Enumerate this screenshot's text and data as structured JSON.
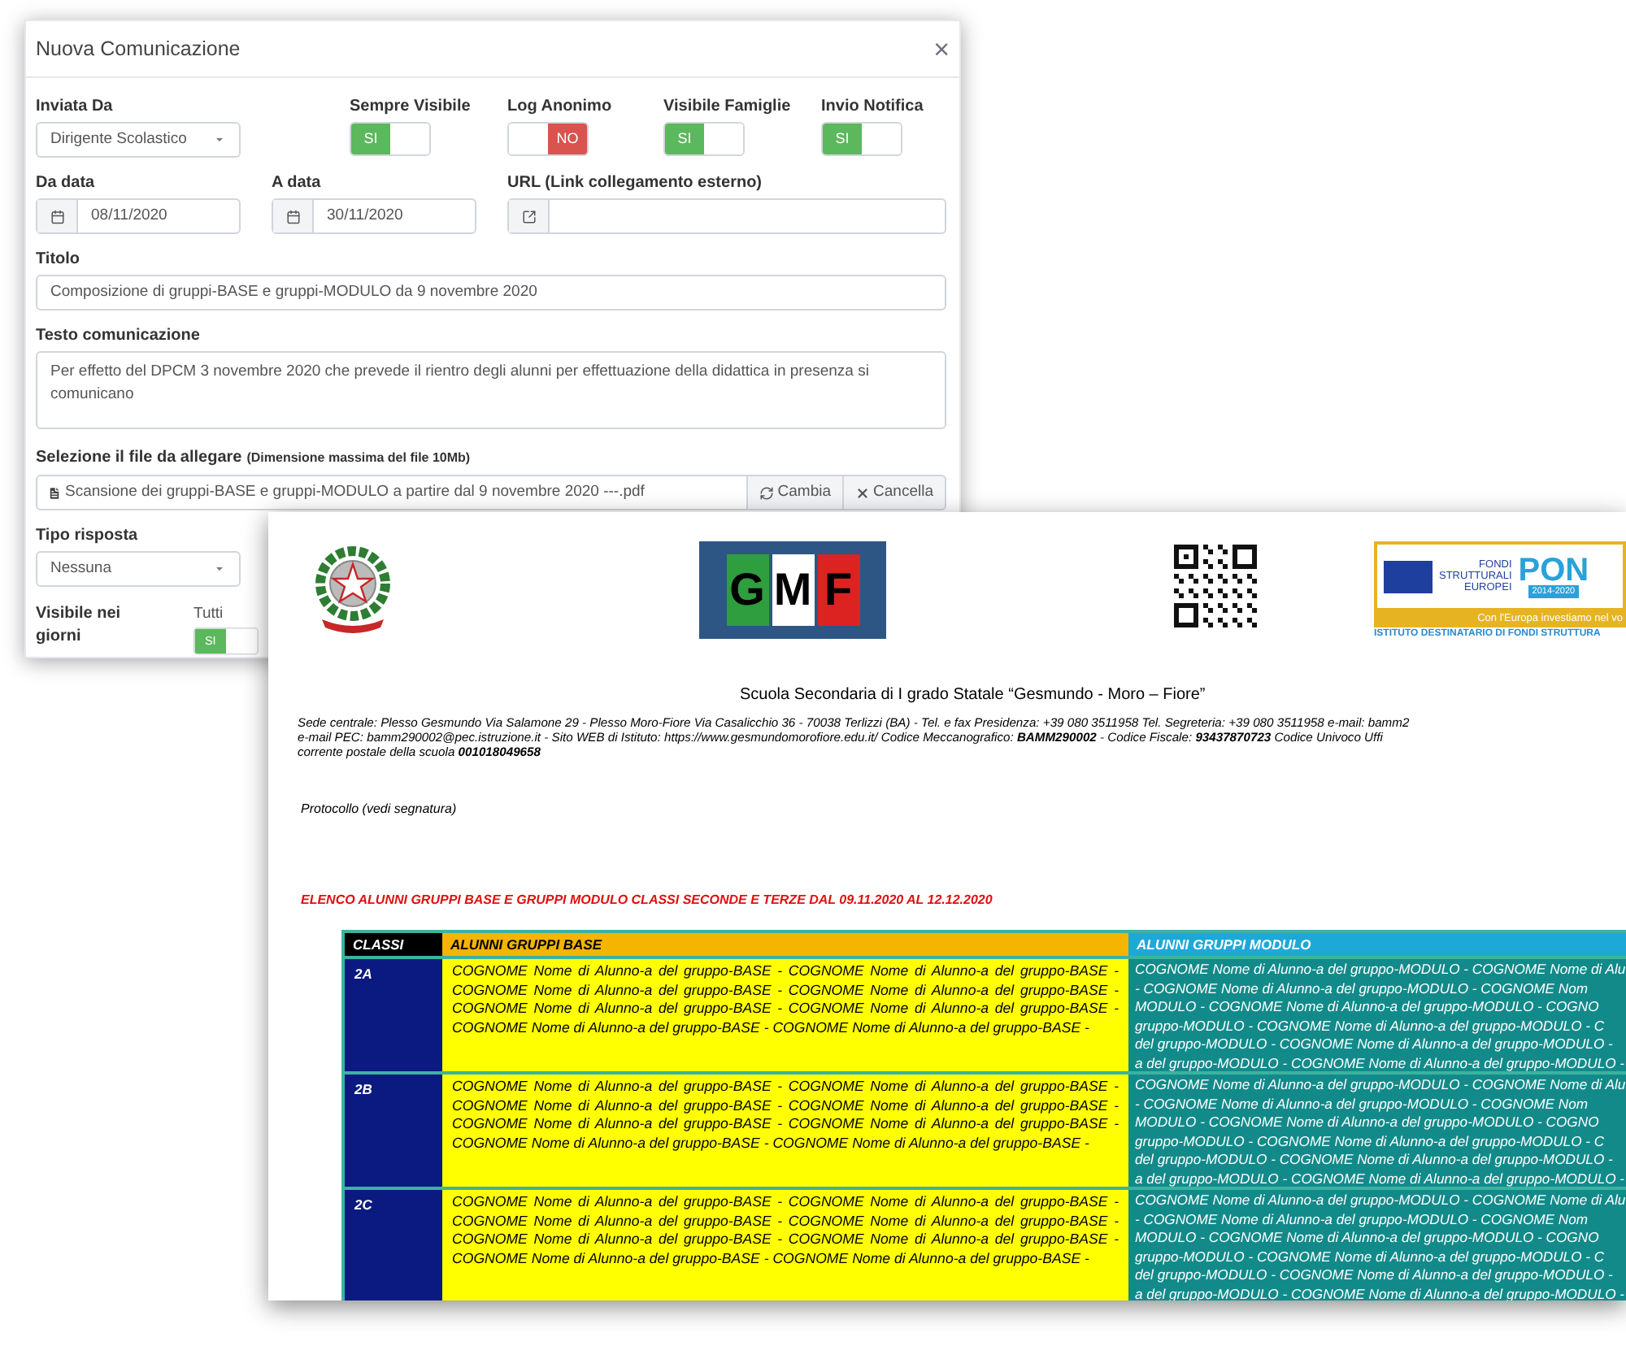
{
  "modal": {
    "title": "Nuova Comunicazione",
    "close": "×",
    "sender": {
      "label": "Inviata Da",
      "value": "Dirigente Scolastico"
    },
    "toggles": [
      {
        "label": "Sempre Visibile",
        "text": "SI",
        "on": true
      },
      {
        "label": "Log Anonimo",
        "text": "NO",
        "on": false
      },
      {
        "label": "Visibile Famiglie",
        "text": "SI",
        "on": true
      },
      {
        "label": "Invio Notifica",
        "text": "SI",
        "on": true
      }
    ],
    "dates": [
      {
        "label": "Da data",
        "value": "08/11/2020"
      },
      {
        "label": "A data",
        "value": "30/11/2020"
      }
    ],
    "url": {
      "label": "URL (Link collegamento esterno)"
    },
    "title_field": {
      "label": "Titolo",
      "value": "Composizione di gruppi-BASE e gruppi-MODULO da 9 novembre 2020"
    },
    "text_field": {
      "label": "Testo comunicazione",
      "value": "Per effetto del DPCM 3 novembre 2020 che prevede il rientro degli alunni per effettuazione della didattica in presenza si comunicano"
    },
    "attachment": {
      "label": "Selezione il file da allegare",
      "hint": "(Dimensione massima del file 10Mb)",
      "file": "Scansione dei gruppi-BASE e gruppi-MODULO a partire dal 9 novembre 2020 ---.pdf",
      "buttons": [
        {
          "kind": "change",
          "label": "Cambia"
        },
        {
          "kind": "clear",
          "label": "Cancella"
        }
      ]
    },
    "response": {
      "label": "Tipo risposta",
      "value": "Nessuna"
    },
    "days": {
      "label": "Visibile nei giorni",
      "option": "Tutti",
      "text": "SI",
      "on": true
    }
  },
  "document": {
    "gmf": [
      "G",
      "M",
      "F"
    ],
    "pon": {
      "words": [
        "FONDI",
        "STRUTTURALI",
        "EUROPEI"
      ],
      "brand": "PON",
      "years": "2014-2020",
      "motto": "Con l'Europa investiamo nel vo",
      "banner": "ISTITUTO DESTINATARIO DI FONDI STRUTTURA"
    },
    "school": "Scuola Secondaria di I grado Statale  “Gesmundo - Moro – Fiore”",
    "info_lines": [
      "Sede centrale: Plesso Gesmundo Via Salamone 29 - Plesso Moro-Fiore Via Casalicchio 36 - 70038 Terlizzi (BA) - Tel. e fax Presidenza: +39 080 3511958 Tel. Segreteria: +39 080 3511958  e-mail: bamm2",
      "e-mail PEC: bamm290002@pec.istruzione.it - Sito WEB di Istituto: https://www.gesmundomorofiore.edu.it/ Codice Meccanografico: **BAMM290002** - Codice Fiscale: **93437870723**  Codice Univoco Uffi",
      "corrente postale  della scuola **001018049658**"
    ],
    "protocol": "Protocollo (vedi segnatura)",
    "list_title": "ELENCO ALUNNI GRUPPI BASE E GRUPPI MODULO CLASSI SECONDE E TERZE  DAL 09.11.2020 AL 12.12.2020",
    "table": {
      "columns": [
        "CLASSI",
        "ALUNNI GRUPPI BASE",
        "ALUNNI GRUPPI MODULO"
      ],
      "rows": [
        {
          "class": "2A",
          "base": [
            "COGNOME Nome di Alunno-a del gruppo-BASE - COGNOME Nome di Alunno-a del gruppo-BASE -",
            "COGNOME Nome di Alunno-a del gruppo-BASE - COGNOME Nome di Alunno-a del gruppo-BASE -",
            "COGNOME Nome di Alunno-a del gruppo-BASE - COGNOME Nome di Alunno-a del gruppo-BASE -",
            "COGNOME Nome di Alunno-a del gruppo-BASE - COGNOME Nome di Alunno-a del gruppo-BASE -"
          ],
          "modulo": [
            "COGNOME Nome di Alunno-a del gruppo-MODULO - COGNOME Nome di Alu",
            "- COGNOME Nome di Alunno-a del gruppo-MODULO - COGNOME Nom",
            "MODULO - COGNOME Nome di Alunno-a del gruppo-MODULO - COGNO",
            "gruppo-MODULO - COGNOME Nome di Alunno-a del gruppo-MODULO - C",
            "del gruppo-MODULO - COGNOME Nome di Alunno-a del gruppo-MODULO -",
            "a del gruppo-MODULO - COGNOME Nome di Alunno-a del gruppo-MODULO -"
          ]
        },
        {
          "class": "2B",
          "base": [
            "COGNOME Nome di Alunno-a del gruppo-BASE - COGNOME Nome di Alunno-a del gruppo-BASE -",
            "COGNOME Nome di Alunno-a del gruppo-BASE - COGNOME Nome di Alunno-a del gruppo-BASE -",
            "COGNOME Nome di Alunno-a del gruppo-BASE - COGNOME Nome di Alunno-a del gruppo-BASE -",
            "COGNOME Nome di Alunno-a del gruppo-BASE - COGNOME Nome di Alunno-a del gruppo-BASE -"
          ],
          "modulo": [
            "COGNOME Nome di Alunno-a del gruppo-MODULO - COGNOME Nome di Alu",
            "- COGNOME Nome di Alunno-a del gruppo-MODULO - COGNOME Nom",
            "MODULO - COGNOME Nome di Alunno-a del gruppo-MODULO - COGNO",
            "gruppo-MODULO - COGNOME Nome di Alunno-a del gruppo-MODULO - C",
            "del gruppo-MODULO - COGNOME Nome di Alunno-a del gruppo-MODULO -",
            "a del gruppo-MODULO - COGNOME Nome di Alunno-a del gruppo-MODULO -"
          ]
        },
        {
          "class": "2C",
          "base": [
            "COGNOME Nome di Alunno-a del gruppo-BASE - COGNOME Nome di Alunno-a del gruppo-BASE -",
            "COGNOME Nome di Alunno-a del gruppo-BASE - COGNOME Nome di Alunno-a del gruppo-BASE -",
            "COGNOME Nome di Alunno-a del gruppo-BASE - COGNOME Nome di Alunno-a del gruppo-BASE -",
            "COGNOME Nome di Alunno-a del gruppo-BASE - COGNOME Nome di Alunno-a del gruppo-BASE -"
          ],
          "modulo": [
            "COGNOME Nome di Alunno-a del gruppo-MODULO - COGNOME Nome di Alu",
            "- COGNOME Nome di Alunno-a del gruppo-MODULO - COGNOME Nom",
            "MODULO - COGNOME Nome di Alunno-a del gruppo-MODULO - COGNO",
            "gruppo-MODULO - COGNOME Nome di Alunno-a del gruppo-MODULO - C",
            "del gruppo-MODULO - COGNOME Nome di Alunno-a del gruppo-MODULO -",
            "a del gruppo-MODULO - COGNOME Nome di Alunno-a del gruppo-MODULO -"
          ]
        }
      ]
    }
  }
}
